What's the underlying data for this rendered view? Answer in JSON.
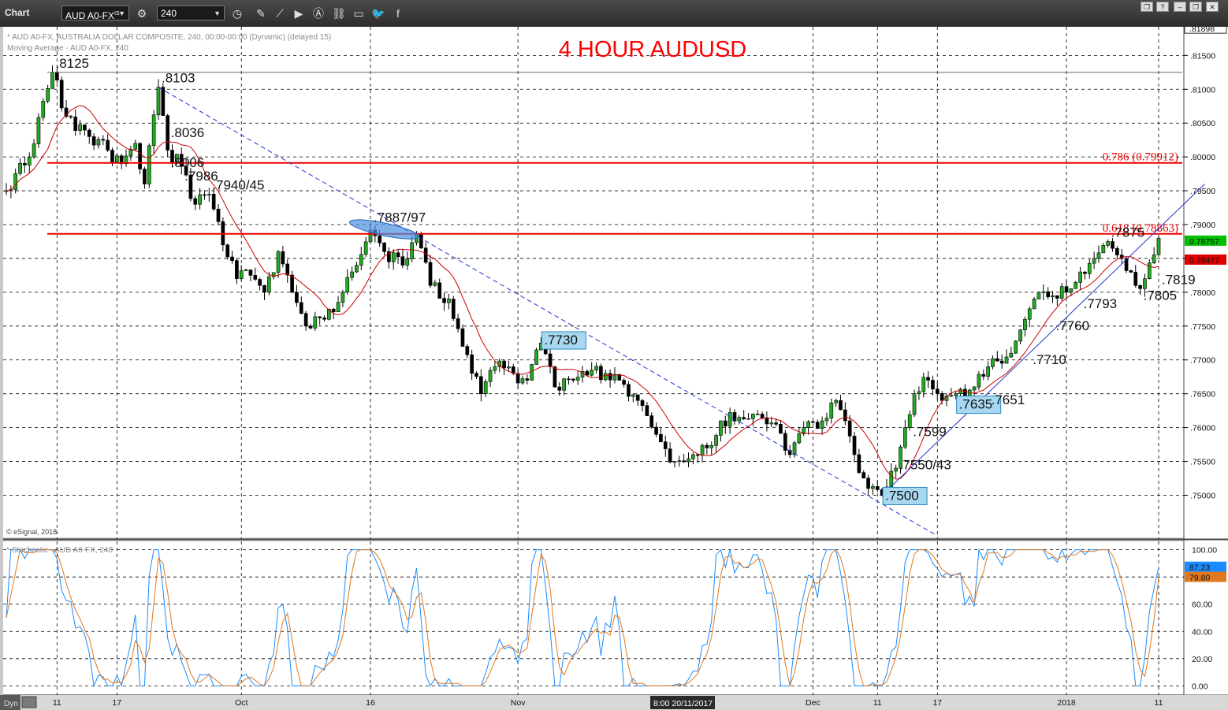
{
  "toolbar": {
    "title": "Chart",
    "symbol": "AUD A0-FX",
    "symbol_superscript": "IS",
    "interval": "240",
    "icons": [
      "settings-icon",
      "clock-icon",
      "pencil-icon",
      "line-icon",
      "play-icon",
      "alert-icon",
      "link-icon",
      "comment-icon",
      "twitter-icon",
      "facebook-icon"
    ]
  },
  "window_buttons": [
    "restore",
    "help",
    "minimize",
    "restore-down",
    "close"
  ],
  "price_panel": {
    "title_line1": "* AUD A0-FX, AUSTRALIA DOLLAR COMPOSITE, 240, 00:00-00:00 (Dynamic) (delayed 15)",
    "title_line2": "Moving Average - AUD A0-FX, 240",
    "watermark": "© eSignal, 2018",
    "chart_title": "4 HOUR AUDUSD",
    "title_color": "#ff0000"
  },
  "stoch_panel": {
    "title": "* Stochastic - AUD A0-FX, 240"
  },
  "footer": {
    "dyn_label": "Dyn",
    "cursor_date": "8:00 20/11/2017"
  },
  "chart_data": [
    {
      "type": "candlestick",
      "title": "4 HOUR AUDUSD",
      "ylim": [
        0.744,
        0.819
      ],
      "y_ticks": [
        ".81500",
        ".81000",
        ".80500",
        ".80000",
        ".79500",
        ".79000",
        ".78500",
        ".78000",
        ".77500",
        ".77000",
        ".76500",
        ".76000",
        ".75500",
        ".75000"
      ],
      "y_tick_values": [
        0.815,
        0.81,
        0.805,
        0.8,
        0.795,
        0.79,
        0.785,
        0.78,
        0.775,
        0.77,
        0.765,
        0.76,
        0.755,
        0.75
      ],
      "axis_top_label": ".81898",
      "axis_top_value": 0.81898,
      "x_labels": [
        "11",
        "17",
        "Oct",
        "16",
        "Nov",
        "Dec",
        "11",
        "17",
        "2018",
        "11"
      ],
      "x_label_bars": [
        11,
        24,
        51,
        79,
        111,
        175,
        189,
        202,
        230,
        250
      ],
      "price_path": [
        [
          0,
          0.795
        ],
        [
          5,
          0.8
        ],
        [
          10,
          0.8125
        ],
        [
          13,
          0.806
        ],
        [
          18,
          0.803
        ],
        [
          22,
          0.801
        ],
        [
          25,
          0.799
        ],
        [
          28,
          0.802
        ],
        [
          30,
          0.796
        ],
        [
          33,
          0.8103
        ],
        [
          35,
          0.801
        ],
        [
          38,
          0.7986
        ],
        [
          41,
          0.793
        ],
        [
          44,
          0.7945
        ],
        [
          47,
          0.787
        ],
        [
          50,
          0.782
        ],
        [
          53,
          0.7825
        ],
        [
          56,
          0.78
        ],
        [
          59,
          0.786
        ],
        [
          62,
          0.78
        ],
        [
          65,
          0.775
        ],
        [
          69,
          0.776
        ],
        [
          73,
          0.78
        ],
        [
          76,
          0.784
        ],
        [
          79,
          0.7892
        ],
        [
          82,
          0.786
        ],
        [
          86,
          0.784
        ],
        [
          89,
          0.7885
        ],
        [
          92,
          0.781
        ],
        [
          96,
          0.779
        ],
        [
          99,
          0.772
        ],
        [
          103,
          0.765
        ],
        [
          106,
          0.769
        ],
        [
          110,
          0.768
        ],
        [
          113,
          0.767
        ],
        [
          116,
          0.7725
        ],
        [
          119,
          0.766
        ],
        [
          123,
          0.767
        ],
        [
          127,
          0.7685
        ],
        [
          130,
          0.768
        ],
        [
          133,
          0.767
        ],
        [
          137,
          0.764
        ],
        [
          141,
          0.759
        ],
        [
          145,
          0.755
        ],
        [
          149,
          0.756
        ],
        [
          152,
          0.757
        ],
        [
          155,
          0.761
        ],
        [
          159,
          0.7615
        ],
        [
          163,
          0.762
        ],
        [
          167,
          0.7605
        ],
        [
          170,
          0.756
        ],
        [
          173,
          0.76
        ],
        [
          177,
          0.761
        ],
        [
          180,
          0.764
        ],
        [
          182,
          0.761
        ],
        [
          184,
          0.756
        ],
        [
          187,
          0.751
        ],
        [
          190,
          0.75
        ],
        [
          193,
          0.754
        ],
        [
          195,
          0.76
        ],
        [
          197,
          0.765
        ],
        [
          200,
          0.767
        ],
        [
          203,
          0.764
        ],
        [
          206,
          0.765
        ],
        [
          210,
          0.766
        ],
        [
          213,
          0.769
        ],
        [
          216,
          0.7695
        ],
        [
          218,
          0.771
        ],
        [
          221,
          0.776
        ],
        [
          224,
          0.78
        ],
        [
          227,
          0.7795
        ],
        [
          230,
          0.78
        ],
        [
          233,
          0.783
        ],
        [
          236,
          0.785
        ],
        [
          239,
          0.7875
        ],
        [
          242,
          0.785
        ],
        [
          245,
          0.781
        ],
        [
          247,
          0.782
        ],
        [
          250,
          0.788
        ]
      ],
      "n_bars": 251,
      "resistance_lines": [
        {
          "label": "0.786 (0.79912)",
          "value": 0.79912
        },
        {
          "label": "0.618 (0.78863)",
          "value": 0.78863
        }
      ],
      "horizontal_lines": [
        {
          "value": 0.8125
        }
      ],
      "annotations": [
        {
          "text": ".8125",
          "value": 0.8125,
          "bar": 10
        },
        {
          "text": ".8103",
          "value": 0.8103,
          "bar": 33
        },
        {
          "text": ".8036",
          "value": 0.8036,
          "bar": 35
        },
        {
          "text": ".8006",
          "value": 0.8006,
          "bar": 35
        },
        {
          "text": ".7986",
          "value": 0.7986,
          "bar": 38
        },
        {
          "text": ".7940/45",
          "value": 0.7945,
          "bar": 44
        },
        {
          "text": ".7887/97",
          "value": 0.7897,
          "bar": 79
        },
        {
          "text": ".7730",
          "value": 0.773,
          "bar": 116,
          "boxed": true
        },
        {
          "text": ".7500",
          "value": 0.75,
          "bar": 190,
          "boxed": true
        },
        {
          "text": ".7550/43",
          "value": 0.755,
          "bar": 193
        },
        {
          "text": ".7599",
          "value": 0.7599,
          "bar": 196
        },
        {
          "text": ".7635",
          "value": 0.7635,
          "bar": 206,
          "boxed": true
        },
        {
          "text": ".7651",
          "value": 0.7651,
          "bar": 213
        },
        {
          "text": ".7710",
          "value": 0.771,
          "bar": 222
        },
        {
          "text": ".7760",
          "value": 0.776,
          "bar": 227
        },
        {
          "text": ".7793",
          "value": 0.7793,
          "bar": 233
        },
        {
          "text": ".7875",
          "value": 0.7875,
          "bar": 239
        },
        {
          "text": ".7819",
          "value": 0.7819,
          "bar": 250
        },
        {
          "text": ".7805",
          "value": 0.7805,
          "bar": 246
        }
      ],
      "price_tags": [
        {
          "text": "0.78757",
          "value": 0.78757,
          "color": "#00c000"
        },
        {
          "text": "0.78477",
          "value": 0.78477,
          "color": "#e00000"
        }
      ],
      "moving_average_color": "#cc0000",
      "downtrend_line": {
        "from": [
          33,
          0.8103
        ],
        "to": [
          202,
          0.744
        ],
        "color": "#2233cc"
      },
      "uptrend_line": {
        "from": [
          190,
          0.75
        ],
        "to": [
          260,
          0.796
        ],
        "color": "#2233cc"
      }
    },
    {
      "type": "line",
      "title": "Stochastic",
      "ylim": [
        -5,
        105
      ],
      "y_ticks": [
        "100.00",
        "80.00",
        "60.00",
        "40.00",
        "20.00",
        "0.00"
      ],
      "y_tick_values": [
        100,
        80,
        60,
        40,
        20,
        0
      ],
      "series": [
        {
          "color": "#1a8cff",
          "last_value": "87.23"
        },
        {
          "color": "#e07820",
          "last_value": "79.80"
        }
      ]
    }
  ]
}
